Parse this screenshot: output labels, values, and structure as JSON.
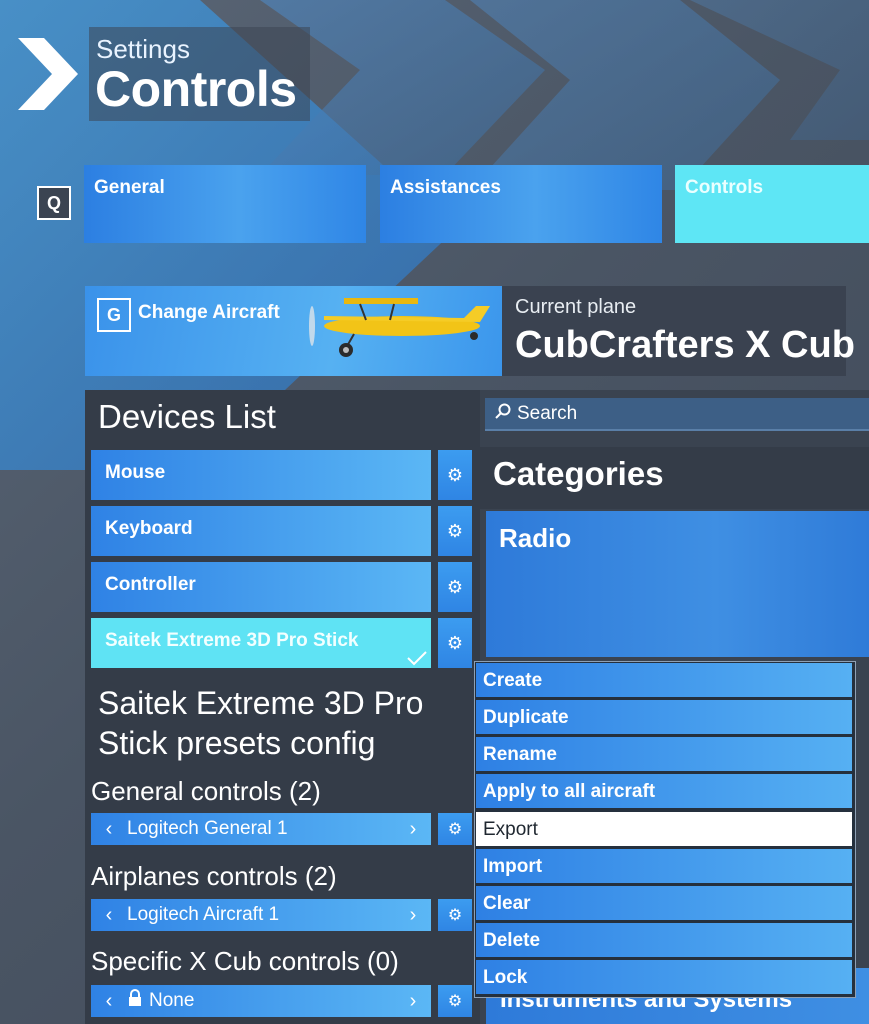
{
  "header": {
    "subtitle": "Settings",
    "title": "Controls"
  },
  "tabs": {
    "key_hint": "Q",
    "items": [
      {
        "label": "General"
      },
      {
        "label": "Assistances"
      },
      {
        "label": "Controls",
        "active": true
      }
    ]
  },
  "aircraft": {
    "key_hint": "G",
    "change_label": "Change Aircraft",
    "current_label": "Current plane",
    "current_name": "CubCrafters X Cub",
    "plane_color": "#f2c417"
  },
  "devices": {
    "title": "Devices List",
    "items": [
      {
        "label": "Mouse"
      },
      {
        "label": "Keyboard"
      },
      {
        "label": "Controller"
      },
      {
        "label": "Saitek Extreme 3D Pro Stick",
        "selected": true
      }
    ]
  },
  "presets": {
    "title_line1": "Saitek Extreme 3D Pro",
    "title_line2": "Stick presets config",
    "sections": [
      {
        "label": "General controls (2)",
        "value": "Logitech General 1",
        "locked": false
      },
      {
        "label": "Airplanes controls (2)",
        "value": "Logitech Aircraft 1",
        "locked": false
      },
      {
        "label": "Specific X Cub controls (0)",
        "value": "None",
        "locked": true
      }
    ]
  },
  "search": {
    "placeholder": "Search"
  },
  "categories": {
    "title": "Categories",
    "first": "Radio",
    "partial_last": "Instruments and Systems"
  },
  "context_menu": {
    "items": [
      {
        "label": "Create"
      },
      {
        "label": "Duplicate"
      },
      {
        "label": "Rename"
      },
      {
        "label": "Apply to all aircraft"
      },
      {
        "label": "Export",
        "highlighted": true
      },
      {
        "label": "Import"
      },
      {
        "label": "Clear"
      },
      {
        "label": "Delete"
      },
      {
        "label": "Lock"
      }
    ]
  },
  "colors": {
    "accent_blue": "#3a92ea",
    "selected_cyan": "#5fe3f4",
    "panel_dark": "#343c48",
    "background": "#4a5564"
  }
}
